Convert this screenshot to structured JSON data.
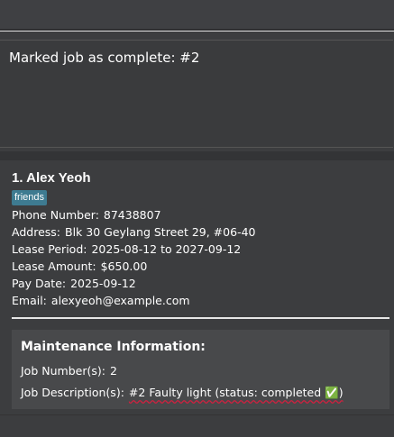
{
  "result": {
    "message": "Marked job as complete: #2"
  },
  "person": {
    "index_name": "1.  Alex Yeoh",
    "tags": [
      "friends"
    ],
    "fields": [
      {
        "label": "Phone Number:",
        "value": "87438807"
      },
      {
        "label": "Address:",
        "value": "Blk 30 Geylang Street 29, #06-40"
      },
      {
        "label": "Lease Period:",
        "value": "2025-08-12 to 2027-09-12"
      },
      {
        "label": "Lease Amount:",
        "value": "$650.00"
      },
      {
        "label": "Pay Date:",
        "value": "2025-09-12"
      },
      {
        "label": "Email:",
        "value": "alexyeoh@example.com"
      }
    ]
  },
  "maintenance": {
    "title": "Maintenance Information:",
    "job_numbers_label": "Job Number(s):",
    "job_numbers_value": "2",
    "job_description_label": "Job Description(s):",
    "job_description_value": "#2 Faulty light (status: completed ✅)"
  },
  "colors": {
    "tag_bg": "#3e7b91",
    "squiggle": "#d02040",
    "panel_bg": "#48494b",
    "background": "#3c3d3f"
  }
}
